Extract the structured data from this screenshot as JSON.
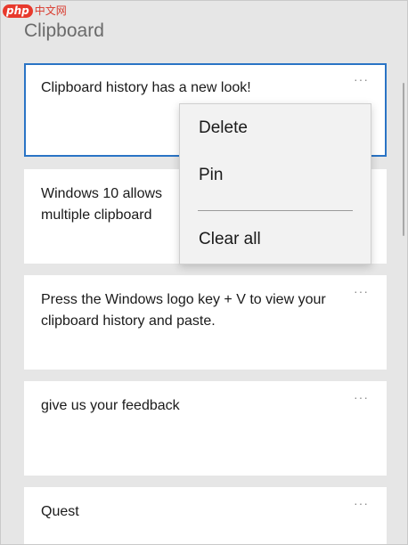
{
  "watermark": {
    "logo": "php",
    "text": "中文网"
  },
  "panel": {
    "title": "Clipboard"
  },
  "items": [
    {
      "text": "Clipboard history has a new look!",
      "more": "···"
    },
    {
      "text": "Windows 10 allows multiple clipboard",
      "more": "···"
    },
    {
      "text": "Press the Windows logo key + V to view your clipboard history and paste.",
      "more": "···"
    },
    {
      "text": "give us your feedback",
      "more": "···"
    },
    {
      "text": "Quest",
      "more": "···"
    }
  ],
  "context_menu": {
    "delete": "Delete",
    "pin": "Pin",
    "clear_all": "Clear all"
  }
}
